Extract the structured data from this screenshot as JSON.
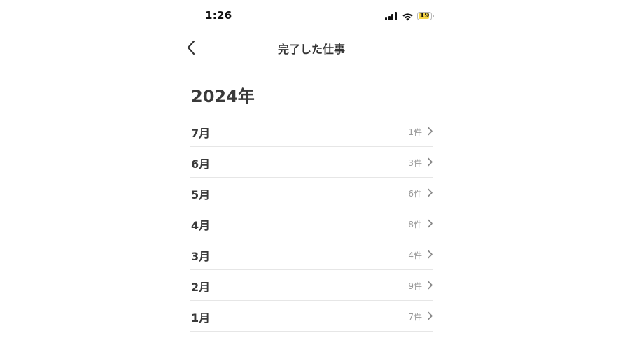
{
  "status_bar": {
    "time": "1:26",
    "battery_level": "19",
    "icons": [
      "signal-icon",
      "wifi-icon",
      "battery-icon"
    ]
  },
  "nav": {
    "title": "完了した仕事",
    "back_icon": "chevron-left-icon"
  },
  "section": {
    "year": "2024年"
  },
  "months": [
    {
      "label": "7月",
      "count": "1件"
    },
    {
      "label": "6月",
      "count": "3件"
    },
    {
      "label": "5月",
      "count": "6件"
    },
    {
      "label": "4月",
      "count": "8件"
    },
    {
      "label": "3月",
      "count": "4件"
    },
    {
      "label": "2月",
      "count": "9件"
    },
    {
      "label": "1月",
      "count": "7件"
    }
  ],
  "colors": {
    "text_primary": "#3a3a3a",
    "text_secondary": "#999999",
    "divider": "#e6e6e6",
    "battery_fill": "#f5d547"
  }
}
